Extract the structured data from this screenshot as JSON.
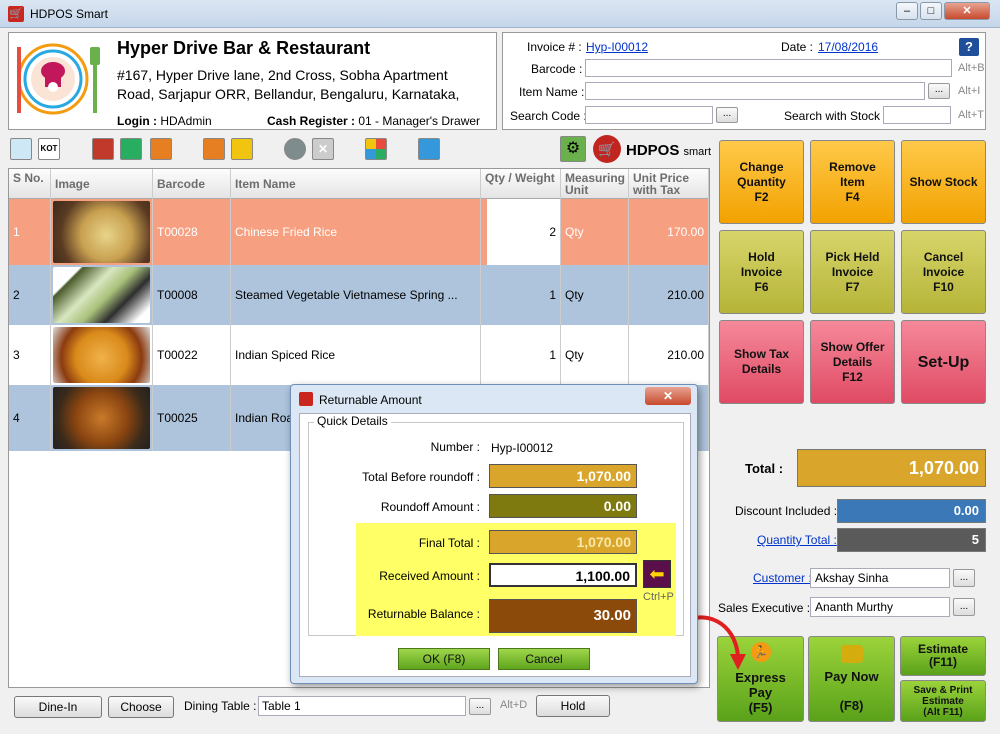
{
  "window": {
    "title": "HDPOS Smart"
  },
  "store": {
    "name": "Hyper Drive Bar & Restaurant",
    "address_line1": "#167, Hyper Drive lane, 2nd Cross, Sobha Apartment",
    "address_line2": "Road, Sarjapur ORR, Bellandur, Bengaluru, Karnataka,",
    "login_label": "Login :",
    "login_value": "HDAdmin",
    "cash_register_label": "Cash Register :",
    "cash_register_value": "01 - Manager's Drawer"
  },
  "invoice": {
    "invoice_label": "Invoice # :",
    "invoice_value": "Hyp-I00012",
    "date_label": "Date :",
    "date_value": "17/08/2016",
    "barcode_label": "Barcode :",
    "barcode_hint": "Alt+B",
    "item_name_label": "Item Name :",
    "item_name_hint": "Alt+I",
    "search_code_label": "Search Code :",
    "search_stock_label": "Search with Stock :",
    "search_stock_hint": "Alt+T",
    "help": "?",
    "dots": "..."
  },
  "brand": {
    "text": "HDPOS",
    "small": "smart"
  },
  "table": {
    "headers": [
      "S No.",
      "Image",
      "Barcode",
      "Item Name",
      "Qty / Weight",
      "Measuring Unit",
      "Unit Price with Tax"
    ],
    "rows": [
      {
        "sno": "1",
        "barcode": "T00028",
        "name": "Chinese Fried Rice",
        "qty": "2",
        "unit": "Qty",
        "price": "170.00"
      },
      {
        "sno": "2",
        "barcode": "T00008",
        "name": "Steamed Vegetable Vietnamese Spring ...",
        "qty": "1",
        "unit": "Qty",
        "price": "210.00"
      },
      {
        "sno": "3",
        "barcode": "T00022",
        "name": "Indian Spiced Rice",
        "qty": "1",
        "unit": "Qty",
        "price": "210.00"
      },
      {
        "sno": "4",
        "barcode": "T00025",
        "name": "Indian Roa",
        "qty": "",
        "unit": "",
        "price": ""
      }
    ]
  },
  "buttons": {
    "change_qty": [
      "Change",
      "Quantity",
      "F2"
    ],
    "remove_item": [
      "Remove",
      "Item",
      "F4"
    ],
    "show_stock": [
      "Show Stock"
    ],
    "hold_invoice": [
      "Hold",
      "Invoice",
      "F6"
    ],
    "pick_held": [
      "Pick Held",
      "Invoice",
      "F7"
    ],
    "cancel_invoice": [
      "Cancel",
      "Invoice",
      "F10"
    ],
    "show_tax": [
      "Show Tax",
      "Details"
    ],
    "show_offer": [
      "Show Offer",
      "Details",
      "F12"
    ],
    "setup": [
      "Set-Up"
    ],
    "express_pay": [
      "Express",
      "Pay",
      "(F5)"
    ],
    "pay_now": [
      "Pay Now",
      "(F8)"
    ],
    "estimate": [
      "Estimate",
      "(F11)"
    ],
    "save_print": [
      "Save & Print",
      "Estimate",
      "(Alt F11)"
    ]
  },
  "totals": {
    "total_label": "Total :",
    "total_value": "1,070.00",
    "discount_label": "Discount Included :",
    "discount_value": "0.00",
    "qty_total_label": "Quantity Total :",
    "qty_total_value": "5",
    "customer_label": "Customer :",
    "customer_value": "Akshay Sinha",
    "sales_exec_label": "Sales Executive :",
    "sales_exec_value": "Ananth Murthy"
  },
  "bottom": {
    "dine_in": "Dine-In",
    "choose": "Choose",
    "dining_table_label": "Dining Table :",
    "dining_table_value": "Table 1",
    "hint": "Alt+D",
    "hold": "Hold"
  },
  "dialog": {
    "title": "Returnable Amount",
    "group": "Quick Details",
    "number_label": "Number :",
    "number_value": "Hyp-I00012",
    "total_before_label": "Total  Before roundoff :",
    "total_before_value": "1,070.00",
    "roundoff_label": "Roundoff Amount :",
    "roundoff_value": "0.00",
    "final_total_label": "Final Total :",
    "final_total_value": "1,070.00",
    "received_label": "Received  Amount :",
    "received_value": "1,100.00",
    "ctrl_hint": "Ctrl+P",
    "returnable_label": "Returnable Balance :",
    "returnable_value": "30.00",
    "ok": "OK (F8)",
    "cancel": "Cancel"
  },
  "colors": {
    "selected_row": "#f6a081",
    "alt_row": "#aec4dc",
    "gold": "#d9a52b",
    "olive": "#7e7a10",
    "brown": "#8b4a0a",
    "highlight": "#ffff66"
  }
}
